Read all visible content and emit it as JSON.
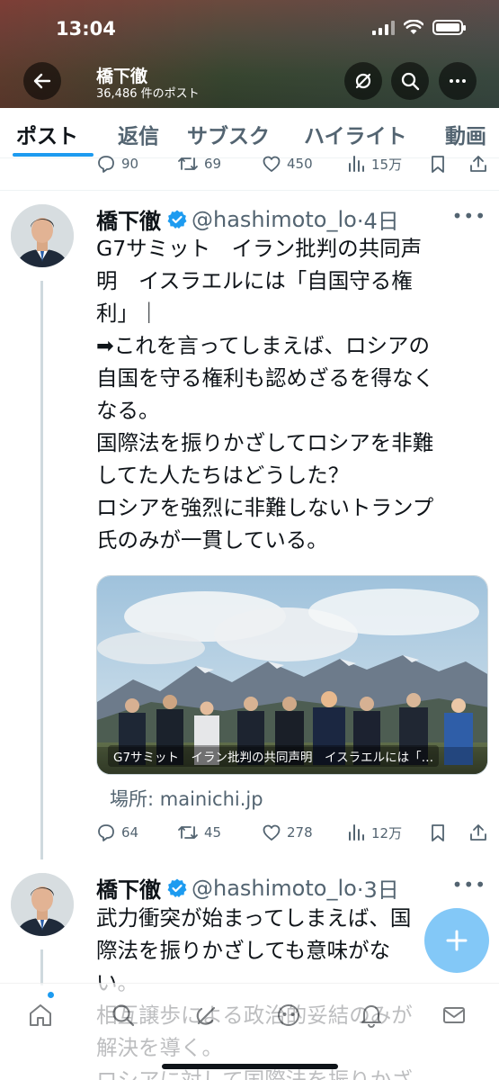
{
  "status_bar": {
    "time": "13:04"
  },
  "profile_header": {
    "name": "橋下徹",
    "post_count": "36,486 件のポスト"
  },
  "tabs": [
    {
      "label": "ポスト",
      "active": true
    },
    {
      "label": "返信",
      "active": false
    },
    {
      "label": "サブスク",
      "active": false
    },
    {
      "label": "ハイライト",
      "active": false
    },
    {
      "label": "動画",
      "active": false
    }
  ],
  "previous_post_actions": {
    "replies": "90",
    "reposts": "69",
    "likes": "450",
    "views": "15万"
  },
  "posts": [
    {
      "name": "橋下徹",
      "verified": true,
      "handle": "@hashimoto_lo",
      "time": "·4日",
      "text": "G7サミット　イラン批判の共同声\n明　イスラエルには「自国守る権\n利」｜\n➡これを言ってしまえば、ロシアの\n自国を守る権利も認めざるを得なく\nなる。\n国際法を振りかざしてロシアを非難\nしてた人たちはどうした？\nロシアを強烈に非難しないトランプ\n氏のみが一貫している。",
      "card": {
        "caption": "G7サミット　イラン批判の共同声明　イスラエルには「…",
        "source": "場所: mainichi.jp"
      },
      "actions": {
        "replies": "64",
        "reposts": "45",
        "likes": "278",
        "views": "12万"
      }
    },
    {
      "name": "橋下徹",
      "verified": true,
      "handle": "@hashimoto_lo",
      "time": "·3日",
      "text": "武力衝突が始まってしまえば、国\n際法を振りかざしても意味がな\nい。\n相互譲歩による政治的妥結のみが\n解決を導く。\nロシアに対して国際法を振りかざ"
    }
  ],
  "icons": {
    "back": "arrow-left-icon",
    "not_following": "slashed-circle-icon",
    "search": "search-icon",
    "more": "more-icon",
    "reply": "reply-icon",
    "repost": "repost-icon",
    "like": "heart-icon",
    "views": "views-icon",
    "bookmark": "bookmark-icon",
    "share": "share-icon",
    "compose": "plus-icon",
    "nav_home": "home-icon",
    "nav_search": "search-icon",
    "nav_grok": "grok-icon",
    "nav_communities": "communities-icon",
    "nav_notifications": "bell-icon",
    "nav_messages": "mail-icon"
  },
  "colors": {
    "accent": "#1d9bf0",
    "verified": "#1d9bf0",
    "text": "#0f1419",
    "muted": "#536471"
  }
}
